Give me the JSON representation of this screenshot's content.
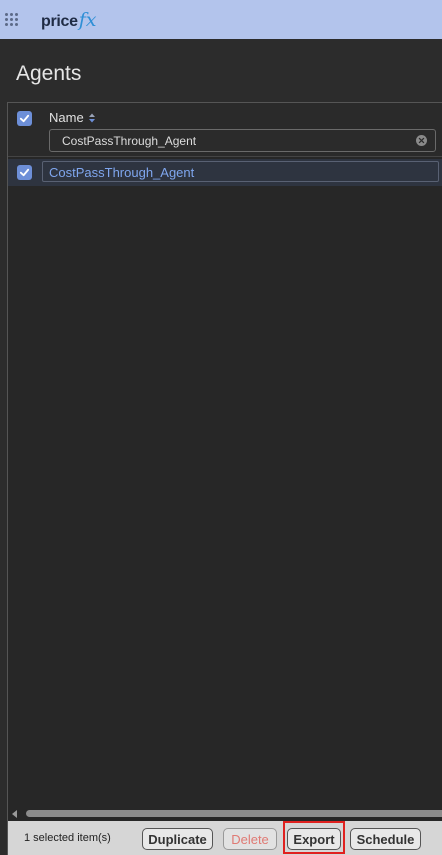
{
  "header": {
    "logo_text": "price",
    "logo_suffix": "fx"
  },
  "page": {
    "title": "Agents"
  },
  "grid": {
    "columns": [
      {
        "label": "Name",
        "sorted": true
      }
    ],
    "filter": {
      "value": "CostPassThrough_Agent",
      "placeholder": ""
    },
    "rows": [
      {
        "name": "CostPassThrough_Agent",
        "selected": true
      }
    ],
    "header_checkbox_checked": true
  },
  "footer": {
    "selected_count": "1 selected item(s)",
    "duplicate_label": "Duplicate",
    "delete_label": "Delete",
    "export_label": "Export",
    "schedule_label": "Schedule"
  },
  "colors": {
    "topbar": "#b3c4ec",
    "accent": "#6d8fd8",
    "link": "#7fa6ee",
    "highlight": "#e0211f"
  },
  "icons": [
    "apps-grid-icon",
    "sort-icon",
    "clear-icon",
    "check-icon",
    "scroll-left-icon"
  ]
}
